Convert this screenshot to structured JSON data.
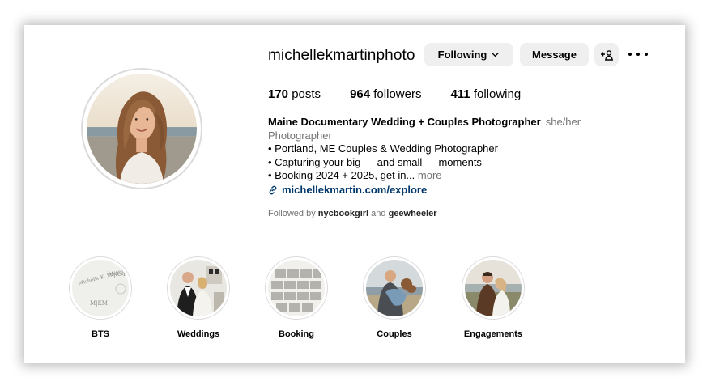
{
  "profile": {
    "username": "michellekmartinphoto",
    "following_label": "Following",
    "message_label": "Message",
    "posts_count": "170",
    "posts_label": "posts",
    "followers_count": "964",
    "followers_label": "followers",
    "following_count": "411",
    "following_stat_label": "following"
  },
  "bio": {
    "name": "Maine Documentary Wedding + Couples Photographer",
    "pronouns": "she/her",
    "category": "Photographer",
    "lines": [
      "• Portland, ME Couples & Wedding Photographer",
      "• Capturing your big — and small — moments",
      "• Booking 2024 + 2025, get in..."
    ],
    "more_label": "more",
    "link_text": "michellekmartin.com/explore"
  },
  "followed_by": {
    "prefix": "Followed by",
    "user1": "nycbookgirl",
    "conj": "and",
    "user2": "geewheeler"
  },
  "highlights": [
    {
      "label": "BTS"
    },
    {
      "label": "Weddings"
    },
    {
      "label": "Booking"
    },
    {
      "label": "Couples"
    },
    {
      "label": "Engagements"
    }
  ],
  "bts_cover_text": {
    "monogram": "M|KM",
    "name_a": "Michelle K. Martin"
  },
  "colors": {
    "link": "#00376b",
    "secondary_text": "#737373",
    "button_bg": "#efefef"
  },
  "icons": [
    "chevron-down-icon",
    "add-user-icon",
    "more-icon",
    "link-icon"
  ]
}
